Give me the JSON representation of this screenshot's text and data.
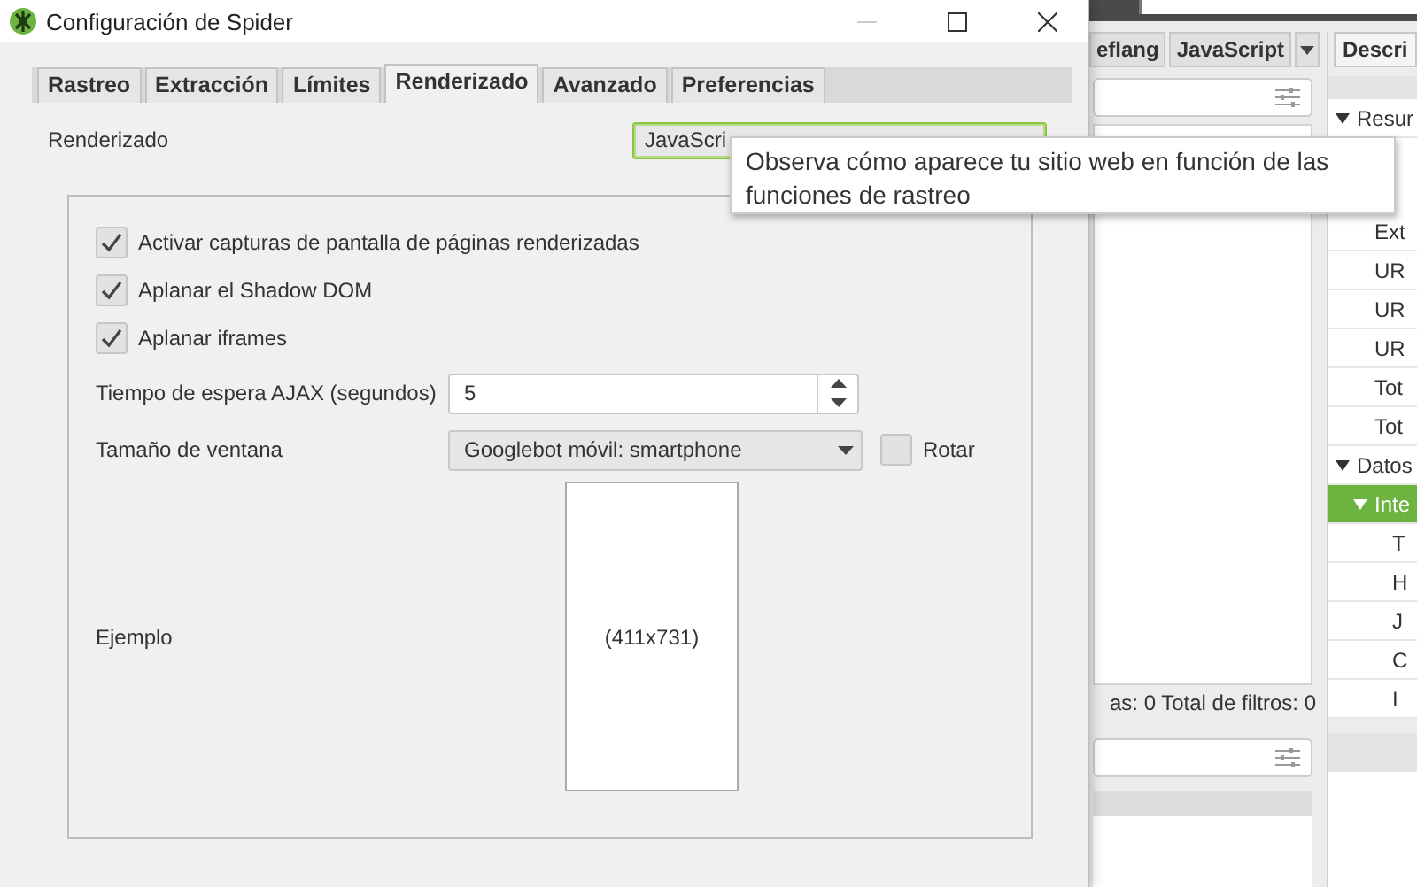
{
  "background_app": {
    "middle_panel": {
      "tabs": [
        {
          "label": "eflang",
          "selected": false
        },
        {
          "label": "JavaScript",
          "selected": false
        }
      ],
      "status": "as: 0 Total de filtros: 0"
    },
    "right_panel": {
      "tabs": [
        {
          "label": "Descri",
          "selected": true
        }
      ],
      "tree": [
        {
          "label": "Resur",
          "expanded": true,
          "selected": false,
          "children": [
            {
              "label": "Ext",
              "selected": false
            },
            {
              "label": "UR",
              "selected": false
            },
            {
              "label": "UR",
              "selected": false
            },
            {
              "label": "UR",
              "selected": false
            },
            {
              "label": "Tot",
              "selected": false
            },
            {
              "label": "Tot",
              "selected": false
            }
          ]
        },
        {
          "label": "Datos",
          "expanded": true,
          "selected": false,
          "children": [
            {
              "label": "Inte",
              "expanded": true,
              "selected": true,
              "children": [
                {
                  "label": "T",
                  "selected": false
                },
                {
                  "label": "H",
                  "selected": false
                },
                {
                  "label": "J",
                  "selected": false
                },
                {
                  "label": "C",
                  "selected": false
                },
                {
                  "label": "I",
                  "selected": false
                }
              ]
            }
          ]
        }
      ]
    }
  },
  "dialog": {
    "title": "Configuración de Spider",
    "tabs": [
      {
        "label": "Rastreo",
        "selected": false
      },
      {
        "label": "Extracción",
        "selected": false
      },
      {
        "label": "Límites",
        "selected": false
      },
      {
        "label": "Renderizado",
        "selected": true
      },
      {
        "label": "Avanzado",
        "selected": false
      },
      {
        "label": "Preferencias",
        "selected": false
      }
    ],
    "rendering": {
      "label": "Renderizado",
      "value": "JavaScri"
    },
    "options": [
      {
        "label": "Activar capturas de pantalla de páginas renderizadas",
        "checked": true
      },
      {
        "label": "Aplanar el Shadow DOM",
        "checked": true
      },
      {
        "label": "Aplanar iframes",
        "checked": true
      }
    ],
    "ajax_timeout": {
      "label": "Tiempo de espera AJAX (segundos)",
      "value": "5"
    },
    "window_size": {
      "label": "Tamaño de ventana",
      "value": "Googlebot móvil: smartphone",
      "rotate": {
        "label": "Rotar",
        "checked": false
      }
    },
    "example": {
      "label": "Ejemplo",
      "size": "(411x731)"
    }
  },
  "tooltip": "Observa cómo aparece tu sitio web en función de las funciones de rastreo"
}
